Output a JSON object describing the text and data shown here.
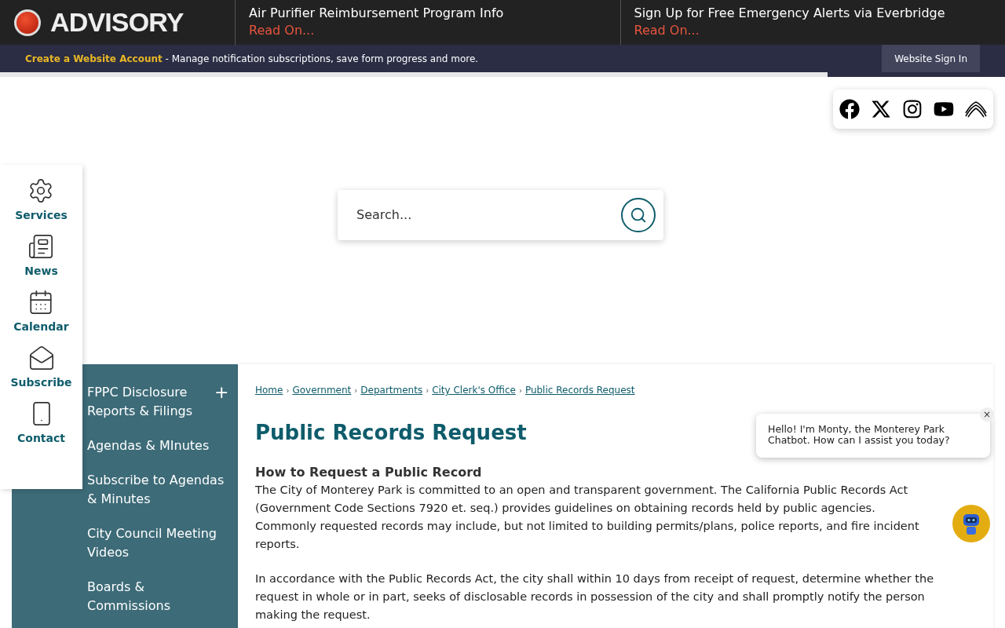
{
  "advisory": {
    "label": "ADVISORY",
    "items": [
      {
        "title": "Air Purifier Reimbursement Program Info",
        "link": "Read On..."
      },
      {
        "title": "Sign Up for Free Emergency Alerts via Everbridge",
        "link": "Read On..."
      }
    ]
  },
  "account_bar": {
    "link": "Create a Website Account",
    "text": " - Manage notification subscriptions, save form progress and more.",
    "sign_in": "Website Sign In"
  },
  "search": {
    "placeholder": "Search..."
  },
  "quick_links": [
    {
      "kind": "services",
      "label": "Services"
    },
    {
      "kind": "news",
      "label": "News"
    },
    {
      "kind": "calendar",
      "label": "Calendar"
    },
    {
      "kind": "subscribe",
      "label": "Subscribe"
    },
    {
      "kind": "contact",
      "label": "Contact"
    }
  ],
  "sidebar": {
    "items": [
      {
        "label": "FPPC Disclosure Reports & Filings",
        "expander": "+",
        "expanded": false
      },
      {
        "label": "Agendas & MInutes"
      },
      {
        "label": "Subscribe to Agendas & Minutes"
      },
      {
        "label": "City Council Meeting Videos"
      },
      {
        "label": "Boards & Commissions"
      }
    ]
  },
  "breadcrumb": {
    "separators": [
      "›",
      "›",
      "›",
      "›"
    ],
    "items": [
      "Home",
      "Government",
      "Departments",
      "City Clerk's Office",
      "Public Records Request"
    ]
  },
  "page_title": "Public Records Request",
  "section_heading": "How to Request a Public Record",
  "paragraphs": [
    "The City of Monterey Park is committed to an open and transparent government. The California Public Records Act (Government Code Sections 7920 et. seq.) provides guidelines on obtaining records held by public agencies. Commonly requested records may include, but not limited to building permits/plans, police reports, and fire incident reports.",
    "In accordance with the Public Records Act, the city shall within 10 days from receipt of request, determine whether the request in whole or in part, seeks of disclosable records in possession of the city and shall promptly notify the person making the request."
  ],
  "chat": {
    "message": "Hello! I'm Monty, the Monterey Park Chatbot. How can I assist you today?",
    "close": "×"
  }
}
